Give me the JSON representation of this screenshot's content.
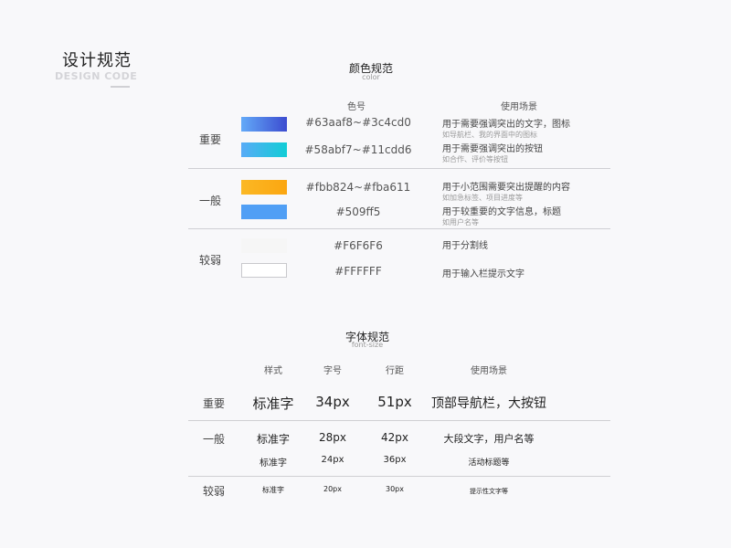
{
  "header": {
    "title": "设计规范",
    "subtitle": "DESIGN CODE"
  },
  "color_section": {
    "title": "颜色规范",
    "subtitle": "color",
    "columns": {
      "code": "色号",
      "usage": "使用场景"
    },
    "groups": [
      {
        "label": "重要"
      },
      {
        "label": "一般"
      },
      {
        "label": "较弱"
      }
    ],
    "rows": [
      {
        "code": "#63aaf8~#3c4cd0",
        "usage": "用于需要强调突出的文字，图标",
        "note": "如导航栏、我的界面中的图标",
        "color_from": "#63aaf8",
        "color_to": "#3c4cd0"
      },
      {
        "code": "#58abf7~#11cdd6",
        "usage": "用于需要强调突出的按钮",
        "note": "如合作、评价等按钮",
        "color_from": "#58abf7",
        "color_to": "#11cdd6"
      },
      {
        "code": "#fbb824~#fba611",
        "usage": "用于小范围需要突出提醒的内容",
        "note": "如加急标签、项目进度等",
        "color_from": "#fbb824",
        "color_to": "#fba611"
      },
      {
        "code": "#509ff5",
        "usage": "用于较重要的文字信息，标题",
        "note": "如用户名等",
        "color_from": "#509ff5",
        "color_to": "#509ff5"
      },
      {
        "code": "#F6F6F6",
        "usage": "用于分割线",
        "note": "",
        "color_from": "#F6F6F6",
        "color_to": "#F6F6F6"
      },
      {
        "code": "#FFFFFF",
        "usage": "用于输入栏提示文字",
        "note": "",
        "color_from": "#FFFFFF",
        "color_to": "#FFFFFF"
      }
    ]
  },
  "font_section": {
    "title": "字体规范",
    "subtitle": "font-size",
    "columns": {
      "style": "样式",
      "size": "字号",
      "line_height": "行距",
      "usage": "使用场景"
    },
    "groups": [
      {
        "label": "重要"
      },
      {
        "label": "一般"
      },
      {
        "label": "较弱"
      }
    ],
    "rows": [
      {
        "style": "标准字",
        "size": "34px",
        "line_height": "51px",
        "usage": "顶部导航栏，大按钮"
      },
      {
        "style": "标准字",
        "size": "28px",
        "line_height": "42px",
        "usage": "大段文字，用户名等"
      },
      {
        "style": "标准字",
        "size": "24px",
        "line_height": "36px",
        "usage": "活动标题等"
      },
      {
        "style": "标准字",
        "size": "20px",
        "line_height": "30px",
        "usage": "提示性文字等"
      }
    ]
  }
}
